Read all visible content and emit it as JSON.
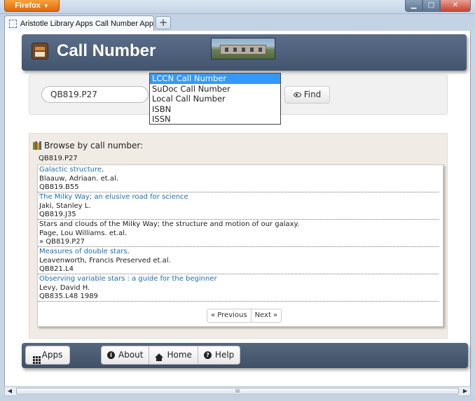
{
  "browser": {
    "menu_label": "Firefox",
    "tab_title": "Aristotle Library Apps Call Number App",
    "new_tab_label": "+",
    "controls": {
      "minimize": "▁",
      "maximize": "□",
      "close": "✕"
    }
  },
  "header": {
    "title": "Call Number"
  },
  "search": {
    "value": "QB819.P27",
    "selected_type": "LCCN Call Number",
    "find_label": "Find",
    "type_options": [
      "LCCN Call Number",
      "SuDoc Call Number",
      "Local Call Number",
      "ISBN",
      "ISSN"
    ]
  },
  "browse": {
    "heading": "Browse by call number:",
    "current": "QB819.P27",
    "results": [
      {
        "title": "Galactic structure,",
        "author": "Blaauw, Adriaan. et.al.",
        "call": "QB819.B55",
        "linked": true
      },
      {
        "title": "The Milky Way; an elusive road for science",
        "author": "Jaki, Stanley L.",
        "call": "QB819.J35",
        "linked": true
      },
      {
        "title": "Stars and clouds of the Milky Way; the structure and motion of our galaxy.",
        "author": "Page, Lou Williams. et.al.",
        "call": "» QB819.P27",
        "linked": false
      },
      {
        "title": "Measures of double stars,",
        "author": "Leavenworth, Francis Preserved et.al.",
        "call": "QB821.L4",
        "linked": true
      },
      {
        "title": "Observing variable stars : a guide for the beginner",
        "author": "Levy, David H.",
        "call": "QB835.L48 1989",
        "linked": true
      }
    ],
    "pager": {
      "previous": "« Previous",
      "next": "Next »"
    }
  },
  "footer": {
    "apps_label": "Apps",
    "about_label": "About",
    "home_label": "Home",
    "help_label": "Help"
  },
  "scrollbar": {
    "grip": "III"
  },
  "colors": {
    "header_bg": "#4b5d78",
    "link": "#1f6fb2",
    "selected_option": "#3399ff",
    "browse_bg": "#f0ebe5"
  }
}
